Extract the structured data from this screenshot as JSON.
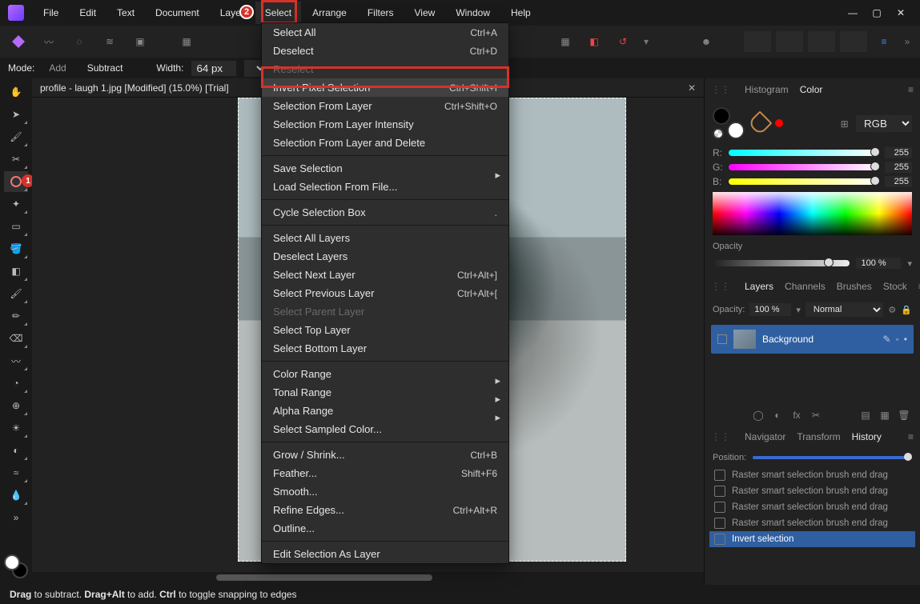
{
  "menubar": {
    "items": [
      "File",
      "Edit",
      "Text",
      "Document",
      "Layer",
      "Select",
      "Arrange",
      "Filters",
      "View",
      "Window",
      "Help"
    ],
    "selected_index": 5
  },
  "callouts": {
    "one": "1",
    "two": "2"
  },
  "options": {
    "mode_label": "Mode:",
    "add": "Add",
    "subtract": "Subtract",
    "width_label": "Width:",
    "width_value": "64 px"
  },
  "document_tab": {
    "title": "profile - laugh 1.jpg [Modified] (15.0%) [Trial]"
  },
  "tool_names": [
    "hand-tool",
    "move-tool",
    "brush-generic",
    "crop-tool",
    "selection-brush-tool",
    "magic-wand",
    "marquee",
    "flood-fill",
    "gradient",
    "paint-brush",
    "pixel-tool",
    "eraser",
    "smudge",
    "blur",
    "clone",
    "dodge",
    "burn",
    "sponge",
    "color-picker",
    "more-tools",
    "more"
  ],
  "select_menu": [
    {
      "label": "Select All",
      "shortcut": "Ctrl+A"
    },
    {
      "label": "Deselect",
      "shortcut": "Ctrl+D"
    },
    {
      "label": "Reselect",
      "shortcut": "",
      "disabled": true
    },
    {
      "label": "Invert Pixel Selection",
      "shortcut": "Ctrl+Shift+I",
      "highlight": true
    },
    {
      "label": "Selection From Layer",
      "shortcut": "Ctrl+Shift+O"
    },
    {
      "label": "Selection From Layer Intensity",
      "shortcut": ""
    },
    {
      "label": "Selection From Layer and Delete",
      "shortcut": ""
    },
    {
      "sep": true
    },
    {
      "label": "Save Selection",
      "shortcut": "",
      "submenu": true
    },
    {
      "label": "Load Selection From File...",
      "shortcut": ""
    },
    {
      "sep": true
    },
    {
      "label": "Cycle Selection Box",
      "shortcut": "."
    },
    {
      "sep": true
    },
    {
      "label": "Select All Layers",
      "shortcut": ""
    },
    {
      "label": "Deselect Layers",
      "shortcut": ""
    },
    {
      "label": "Select Next Layer",
      "shortcut": "Ctrl+Alt+]"
    },
    {
      "label": "Select Previous Layer",
      "shortcut": "Ctrl+Alt+["
    },
    {
      "label": "Select Parent Layer",
      "shortcut": "",
      "disabled": true
    },
    {
      "label": "Select Top Layer",
      "shortcut": ""
    },
    {
      "label": "Select Bottom Layer",
      "shortcut": ""
    },
    {
      "sep": true
    },
    {
      "label": "Color Range",
      "shortcut": "",
      "submenu": true
    },
    {
      "label": "Tonal Range",
      "shortcut": "",
      "submenu": true
    },
    {
      "label": "Alpha Range",
      "shortcut": "",
      "submenu": true
    },
    {
      "label": "Select Sampled Color...",
      "shortcut": ""
    },
    {
      "sep": true
    },
    {
      "label": "Grow / Shrink...",
      "shortcut": "Ctrl+B"
    },
    {
      "label": "Feather...",
      "shortcut": "Shift+F6"
    },
    {
      "label": "Smooth...",
      "shortcut": ""
    },
    {
      "label": "Refine Edges...",
      "shortcut": "Ctrl+Alt+R"
    },
    {
      "label": "Outline...",
      "shortcut": ""
    },
    {
      "sep": true
    },
    {
      "label": "Edit Selection As Layer",
      "shortcut": ""
    }
  ],
  "panels": {
    "top_tabs": [
      "Histogram",
      "Color"
    ],
    "top_active": 1,
    "color": {
      "mode": "RGB",
      "channels": [
        {
          "label": "R:",
          "value": "255",
          "gradient": "linear-gradient(90deg,#00ffff,#ffffff)"
        },
        {
          "label": "G:",
          "value": "255",
          "gradient": "linear-gradient(90deg,#ff00ff,#ffffff)"
        },
        {
          "label": "B:",
          "value": "255",
          "gradient": "linear-gradient(90deg,#ffff00,#ffffff)"
        }
      ],
      "opacity_label": "Opacity",
      "opacity_value": "100 %"
    },
    "mid_tabs": [
      "Layers",
      "Channels",
      "Brushes",
      "Stock"
    ],
    "mid_active": 0,
    "layers": {
      "opacity_label": "Opacity:",
      "opacity_value": "100 %",
      "blend": "Normal",
      "items": [
        {
          "name": "Background"
        }
      ]
    },
    "bot_tabs": [
      "Navigator",
      "Transform",
      "History"
    ],
    "bot_active": 2,
    "history": {
      "position_label": "Position:",
      "items": [
        {
          "label": "Raster smart selection brush end drag"
        },
        {
          "label": "Raster smart selection brush end drag"
        },
        {
          "label": "Raster smart selection brush end drag"
        },
        {
          "label": "Raster smart selection brush end drag"
        },
        {
          "label": "Invert selection",
          "selected": true
        }
      ]
    }
  },
  "status": {
    "drag": "Drag",
    "drag_txt": " to subtract. ",
    "dragalt": "Drag+Alt",
    "dragalt_txt": " to add. ",
    "ctrl": "Ctrl",
    "ctrl_txt": " to toggle snapping to edges"
  }
}
